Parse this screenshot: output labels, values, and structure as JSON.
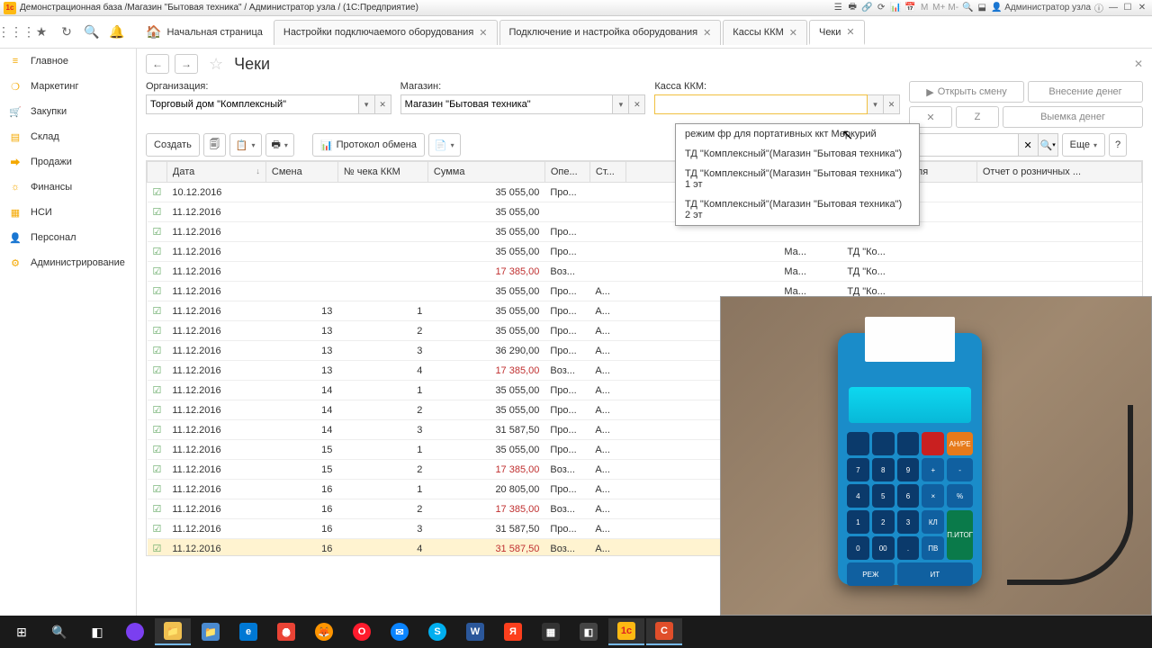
{
  "titlebar": {
    "text": "Демонстрационная база /Магазин \"Бытовая техника\" / Администратор узла / (1С:Предприятие)",
    "user": "Администратор узла"
  },
  "tabs": {
    "home": "Начальная страница",
    "t1": "Настройки подключаемого оборудования",
    "t2": "Подключение и настройка оборудования",
    "t3": "Кассы ККМ",
    "t4": "Чеки"
  },
  "sidebar": {
    "s0": "Главное",
    "s1": "Маркетинг",
    "s2": "Закупки",
    "s3": "Склад",
    "s4": "Продажи",
    "s5": "Финансы",
    "s6": "НСИ",
    "s7": "Персонал",
    "s8": "Администрирование"
  },
  "page": {
    "title": "Чеки"
  },
  "filters": {
    "org_label": "Организация:",
    "org_value": "Торговый дом \"Комплексный\"",
    "shop_label": "Магазин:",
    "shop_value": "Магазин \"Бытовая техника\"",
    "kkm_label": "Касса ККМ:",
    "kkm_value": ""
  },
  "buttons": {
    "open_shift": "Открыть смену",
    "deposit": "Внесение денег",
    "withdraw": "Выемка денег",
    "create": "Создать",
    "protocol": "Протокол обмена",
    "more": "Еще",
    "help": "?"
  },
  "dropdown": {
    "o0": "режим фр для портативных ккт Меркурий",
    "o1": "ТД \"Комплексный\"(Магазин \"Бытовая техника\")",
    "o2": "ТД \"Комплексный\"(Магазин \"Бытовая техника\") 1 эт",
    "o3": "ТД \"Комплексный\"(Магазин \"Бытовая техника\") 2 эт"
  },
  "columns": {
    "c0": "Дата",
    "c1": "Смена",
    "c2": "№ чека ККМ",
    "c3": "Сумма",
    "c4": "Опе...",
    "c5": "Ст...",
    "c_extra1": "Заказ покупателя",
    "c_extra2": "Отчет о розничных ..."
  },
  "rows": [
    {
      "date": "10.12.2016",
      "shift": "",
      "num": "",
      "sum": "35 055,00",
      "op": "Про...",
      "st": "",
      "m": "",
      "td": ""
    },
    {
      "date": "11.12.2016",
      "shift": "",
      "num": "",
      "sum": "35 055,00",
      "op": "",
      "st": "",
      "m": "Ма...",
      "td": "ТД \"Ко..."
    },
    {
      "date": "11.12.2016",
      "shift": "",
      "num": "",
      "sum": "35 055,00",
      "op": "Про...",
      "st": "",
      "m": "",
      "td": ""
    },
    {
      "date": "11.12.2016",
      "shift": "",
      "num": "",
      "sum": "35 055,00",
      "op": "Про...",
      "st": "",
      "m": "Ма...",
      "td": "ТД \"Ко..."
    },
    {
      "date": "11.12.2016",
      "shift": "",
      "num": "",
      "sum": "17 385,00",
      "op": "Воз...",
      "st": "",
      "m": "Ма...",
      "td": "ТД \"Ко...",
      "red": true
    },
    {
      "date": "11.12.2016",
      "shift": "",
      "num": "",
      "sum": "35 055,00",
      "op": "Про...",
      "st": "А...",
      "m": "Ма...",
      "td": "ТД \"Ко..."
    },
    {
      "date": "11.12.2016",
      "shift": "13",
      "num": "1",
      "sum": "35 055,00",
      "op": "Про...",
      "st": "А...",
      "m": "",
      "td": ""
    },
    {
      "date": "11.12.2016",
      "shift": "13",
      "num": "2",
      "sum": "35 055,00",
      "op": "Про...",
      "st": "А...",
      "m": "",
      "td": ""
    },
    {
      "date": "11.12.2016",
      "shift": "13",
      "num": "3",
      "sum": "36 290,00",
      "op": "Про...",
      "st": "А...",
      "m": "",
      "td": ""
    },
    {
      "date": "11.12.2016",
      "shift": "13",
      "num": "4",
      "sum": "17 385,00",
      "op": "Воз...",
      "st": "А...",
      "m": "",
      "td": "",
      "red": true
    },
    {
      "date": "11.12.2016",
      "shift": "14",
      "num": "1",
      "sum": "35 055,00",
      "op": "Про...",
      "st": "А...",
      "m": "",
      "td": ""
    },
    {
      "date": "11.12.2016",
      "shift": "14",
      "num": "2",
      "sum": "35 055,00",
      "op": "Про...",
      "st": "А...",
      "m": "",
      "td": ""
    },
    {
      "date": "11.12.2016",
      "shift": "14",
      "num": "3",
      "sum": "31 587,50",
      "op": "Про...",
      "st": "А...",
      "m": "",
      "td": ""
    },
    {
      "date": "11.12.2016",
      "shift": "15",
      "num": "1",
      "sum": "35 055,00",
      "op": "Про...",
      "st": "А...",
      "m": "",
      "td": ""
    },
    {
      "date": "11.12.2016",
      "shift": "15",
      "num": "2",
      "sum": "17 385,00",
      "op": "Воз...",
      "st": "А...",
      "m": "",
      "td": "",
      "red": true
    },
    {
      "date": "11.12.2016",
      "shift": "16",
      "num": "1",
      "sum": "20 805,00",
      "op": "Про...",
      "st": "А...",
      "m": "",
      "td": ""
    },
    {
      "date": "11.12.2016",
      "shift": "16",
      "num": "2",
      "sum": "17 385,00",
      "op": "Воз...",
      "st": "А...",
      "m": "",
      "td": "",
      "red": true
    },
    {
      "date": "11.12.2016",
      "shift": "16",
      "num": "3",
      "sum": "31 587,50",
      "op": "Про...",
      "st": "А...",
      "m": "",
      "td": ""
    },
    {
      "date": "11.12.2016",
      "shift": "16",
      "num": "4",
      "sum": "31 587,50",
      "op": "Воз...",
      "st": "А...",
      "m": "",
      "td": "",
      "red": true,
      "selected": true
    }
  ]
}
